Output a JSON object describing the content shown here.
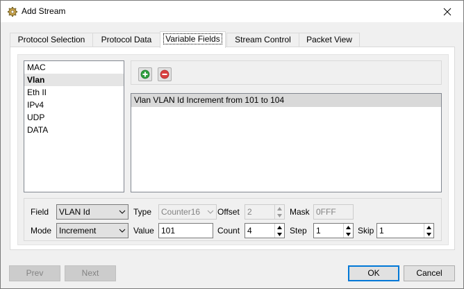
{
  "window": {
    "title": "Add Stream",
    "icon": "gear-icon",
    "close_icon": "close-icon"
  },
  "tabs": [
    {
      "label": "Protocol Selection"
    },
    {
      "label": "Protocol Data"
    },
    {
      "label": "Variable Fields",
      "active": true
    },
    {
      "label": "Stream Control"
    },
    {
      "label": "Packet View"
    }
  ],
  "protocols": [
    "MAC",
    "Vlan",
    "Eth II",
    "IPv4",
    "UDP",
    "DATA"
  ],
  "selected_protocol": "Vlan",
  "toolbar": {
    "add_icon": "add-icon",
    "remove_icon": "remove-icon"
  },
  "variable_fields": [
    "Vlan VLAN Id Increment from 101 to 104"
  ],
  "editor": {
    "field_label": "Field",
    "field_value": "VLAN Id",
    "type_label": "Type",
    "type_value": "Counter16",
    "offset_label": "Offset",
    "offset_value": "2",
    "mask_label": "Mask",
    "mask_value": "0FFF",
    "mode_label": "Mode",
    "mode_value": "Increment",
    "value_label": "Value",
    "value_value": "101",
    "count_label": "Count",
    "count_value": "4",
    "step_label": "Step",
    "step_value": "1",
    "skip_label": "Skip",
    "skip_value": "1"
  },
  "buttons": {
    "prev": "Prev",
    "next": "Next",
    "ok": "OK",
    "cancel": "Cancel"
  },
  "colors": {
    "add_green": "#2e9e3e",
    "remove_red": "#d93f3f",
    "accent": "#0078d7"
  }
}
